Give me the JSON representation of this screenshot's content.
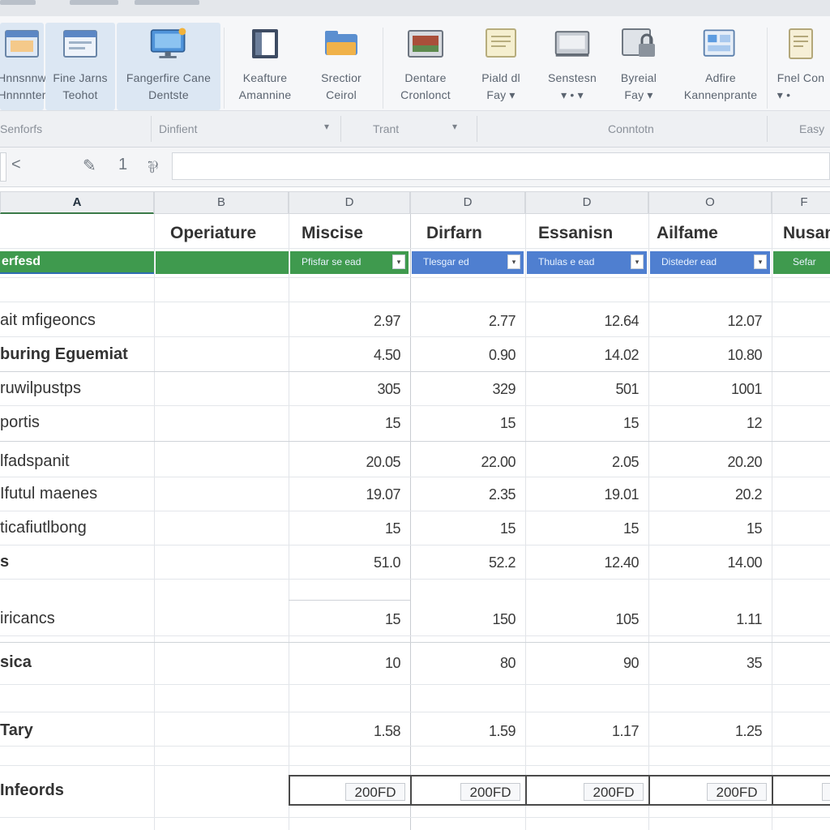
{
  "ribbon": {
    "buttons": [
      {
        "label1": "Hnnsnnw",
        "label2": "Hnnnnter",
        "icon": "table-window-icon"
      },
      {
        "label1": "Fine Jarns",
        "label2": "Teohot",
        "icon": "form-window-icon"
      },
      {
        "label1": "Fangerfire Cane",
        "label2": "Dentste",
        "icon": "monitor-icon"
      },
      {
        "label1": "Keafture",
        "label2": "Amannine",
        "icon": "book-icon"
      },
      {
        "label1": "Srectior",
        "label2": "Ceirol",
        "icon": "folder-icon"
      },
      {
        "label1": "Dentare",
        "label2": "Cronlonct",
        "icon": "image-icon"
      },
      {
        "label1": "Piald dl",
        "label2": "Fay ▾",
        "icon": "note-icon"
      },
      {
        "label1": "Senstesn",
        "label2": "▾ • ▾",
        "icon": "screen-icon"
      },
      {
        "label1": "Byreial",
        "label2": "Fay ▾",
        "icon": "lock-icon"
      },
      {
        "label1": "Adfire",
        "label2": "Kannenprante",
        "icon": "grid-window-icon"
      },
      {
        "label1": "Fnel Con",
        "label2": "▾ •",
        "icon": "document-icon"
      }
    ]
  },
  "groups": {
    "g1": "Senforfs",
    "g2": "Dinfient",
    "g3": "Trant",
    "g4": "Conntotn",
    "g5": "Easy"
  },
  "formula": {
    "cancel": "<",
    "edit": "✎",
    "one": "1",
    "fx": "⅌"
  },
  "columns": [
    "A",
    "B",
    "D",
    "D",
    "D",
    "O",
    "F"
  ],
  "headers": {
    "b": "Operiature",
    "c": "Miscise",
    "d": "Dirfarn",
    "e": "Essanisn",
    "f": "Ailfame",
    "g": "Nusan"
  },
  "bands": {
    "a": "erfesd",
    "c": "Pfisfar se ead",
    "d": "Tlesgar ed",
    "e": "Thulas e ead",
    "f": "Disteder ead",
    "g": "Sefar"
  },
  "rows": [
    {
      "label": "ait mfigeoncs",
      "bold": false,
      "values": [
        "2.97",
        "2.77",
        "12.64",
        "12.07"
      ]
    },
    {
      "label": "buring Eguemiat",
      "bold": true,
      "values": [
        "4.50",
        "0.90",
        "14.02",
        "10.80"
      ]
    },
    {
      "label": "ruwilpustps",
      "bold": false,
      "values": [
        "305",
        "329",
        "501",
        "1001"
      ]
    },
    {
      "label": "portis",
      "bold": false,
      "values": [
        "15",
        "15",
        "15",
        "12"
      ]
    },
    {
      "label": "lfadspanit",
      "bold": false,
      "values": [
        "20.05",
        "22.00",
        "2.05",
        "20.20"
      ]
    },
    {
      "label": "Ifutul maenes",
      "bold": false,
      "values": [
        "19.07",
        "2.35",
        "19.01",
        "20.2"
      ]
    },
    {
      "label": "ticafiutlbong",
      "bold": false,
      "values": [
        "15",
        "15",
        "15",
        "15"
      ]
    },
    {
      "label": "s",
      "bold": true,
      "values": [
        "51.0",
        "52.2",
        "12.40",
        "14.00"
      ]
    },
    {
      "label": "iricancs",
      "bold": false,
      "values": [
        "15",
        "150",
        "105",
        "1.11"
      ]
    },
    {
      "label": "sica",
      "bold": true,
      "values": [
        "10",
        "80",
        "90",
        "35"
      ]
    },
    {
      "label": "Tary",
      "bold": true,
      "values": [
        "1.58",
        "1.59",
        "1.17",
        "1.25"
      ]
    }
  ],
  "totals": {
    "label": "Infeords",
    "values": [
      "200FD",
      "200FD",
      "200FD",
      "200FD"
    ]
  },
  "colors": {
    "green": "#3f9a4e",
    "blue": "#4f7fd0",
    "ribbon_selected": "#dce7f3"
  }
}
